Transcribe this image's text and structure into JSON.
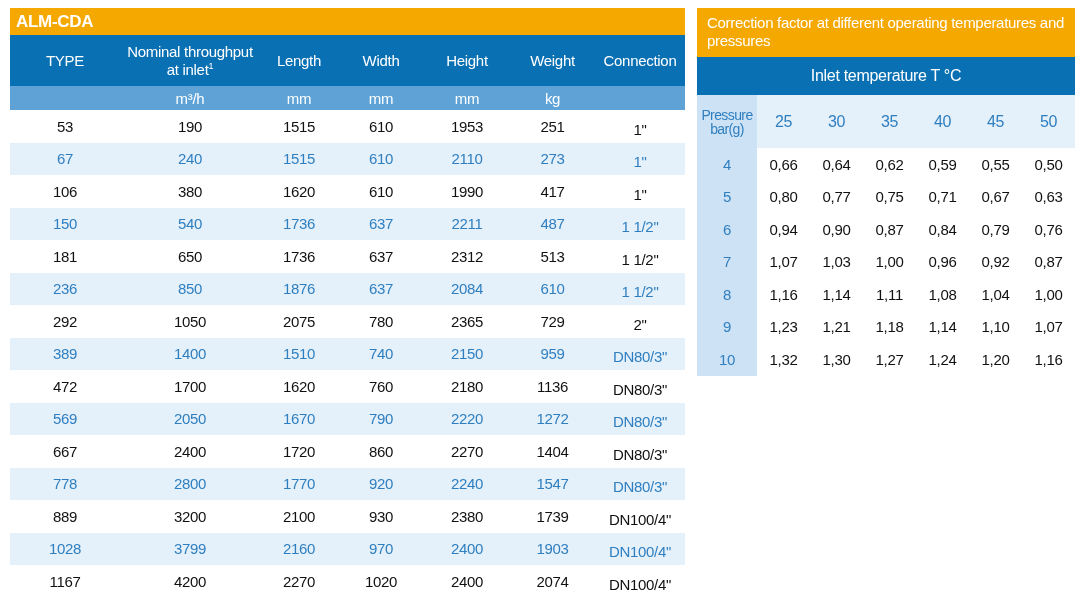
{
  "product_table": {
    "title": "ALM-CDA",
    "columns": [
      {
        "label": "TYPE"
      },
      {
        "label": "Nominal throughput at inlet$^{1}$",
        "unit": "m³/h"
      },
      {
        "label": "Length",
        "unit": "mm"
      },
      {
        "label": "Width",
        "unit": "mm"
      },
      {
        "label": "Height",
        "unit": "mm"
      },
      {
        "label": "Weight",
        "unit": "kg"
      },
      {
        "label": "Connection"
      }
    ],
    "rows": [
      [
        "53",
        "190",
        "1515",
        "610",
        "1953",
        "251",
        "1\""
      ],
      [
        "67",
        "240",
        "1515",
        "610",
        "2110",
        "273",
        "1\""
      ],
      [
        "106",
        "380",
        "1620",
        "610",
        "1990",
        "417",
        "1\""
      ],
      [
        "150",
        "540",
        "1736",
        "637",
        "2211",
        "487",
        "1 1/2\""
      ],
      [
        "181",
        "650",
        "1736",
        "637",
        "2312",
        "513",
        "1 1/2\""
      ],
      [
        "236",
        "850",
        "1876",
        "637",
        "2084",
        "610",
        "1 1/2\""
      ],
      [
        "292",
        "1050",
        "2075",
        "780",
        "2365",
        "729",
        "2\""
      ],
      [
        "389",
        "1400",
        "1510",
        "740",
        "2150",
        "959",
        "DN80/3\""
      ],
      [
        "472",
        "1700",
        "1620",
        "760",
        "2180",
        "1136",
        "DN80/3\""
      ],
      [
        "569",
        "2050",
        "1670",
        "790",
        "2220",
        "1272",
        "DN80/3\""
      ],
      [
        "667",
        "2400",
        "1720",
        "860",
        "2270",
        "1404",
        "DN80/3\""
      ],
      [
        "778",
        "2800",
        "1770",
        "920",
        "2240",
        "1547",
        "DN80/3\""
      ],
      [
        "889",
        "3200",
        "2100",
        "930",
        "2380",
        "1739",
        "DN100/4\""
      ],
      [
        "1028",
        "3799",
        "2160",
        "970",
        "2400",
        "1903",
        "DN100/4\""
      ],
      [
        "1167",
        "4200",
        "2270",
        "1020",
        "2400",
        "2074",
        "DN100/4\""
      ]
    ]
  },
  "correction_table": {
    "title": "Correction factor at different operating temperatures and pressures",
    "header": "Inlet temperature T °C",
    "row_header": "Pressure bar(g)",
    "temperatures": [
      "25",
      "30",
      "35",
      "40",
      "45",
      "50"
    ],
    "rows": [
      {
        "pressure": "4",
        "factors": [
          "0,66",
          "0,64",
          "0,62",
          "0,59",
          "0,55",
          "0,50"
        ]
      },
      {
        "pressure": "5",
        "factors": [
          "0,80",
          "0,77",
          "0,75",
          "0,71",
          "0,67",
          "0,63"
        ]
      },
      {
        "pressure": "6",
        "factors": [
          "0,94",
          "0,90",
          "0,87",
          "0,84",
          "0,79",
          "0,76"
        ]
      },
      {
        "pressure": "7",
        "factors": [
          "1,07",
          "1,03",
          "1,00",
          "0,96",
          "0,92",
          "0,87"
        ]
      },
      {
        "pressure": "8",
        "factors": [
          "1,16",
          "1,14",
          "1,11",
          "1,08",
          "1,04",
          "1,00"
        ]
      },
      {
        "pressure": "9",
        "factors": [
          "1,23",
          "1,21",
          "1,18",
          "1,14",
          "1,10",
          "1,07"
        ]
      },
      {
        "pressure": "10",
        "factors": [
          "1,32",
          "1,30",
          "1,27",
          "1,24",
          "1,20",
          "1,16"
        ]
      }
    ]
  }
}
